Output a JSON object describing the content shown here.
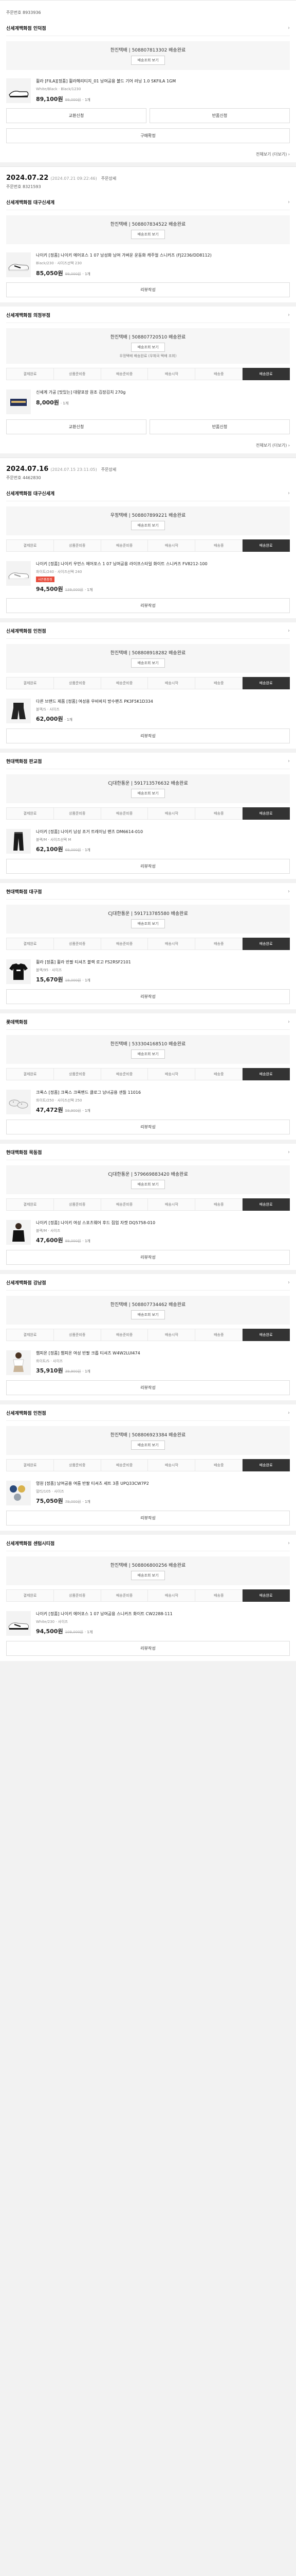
{
  "labels": {
    "ship_btn": "배송조회 보기",
    "exchange": "교환신청",
    "return": "반품신청",
    "confirm": "구매확정",
    "cancel": "취소요청",
    "review": "리뷰작성",
    "detail": "주문상세",
    "more": "전체보기 (더보기) ›",
    "qty": "· 1개"
  },
  "steps": [
    "결제완료",
    "상품준비중",
    "배송준비중",
    "배송시작",
    "배송중",
    "배송완료"
  ],
  "orders": [
    {
      "order_no": "주문번호 8933936",
      "shop": "신세계백화점 인덕점",
      "ship_title": "한진택배 | 508807813302 배송완료",
      "item": {
        "name": "휠라 [FILA][정품] 휠라헤리티지_01 남여공용 볼드 기어 러닝 1.0 SKFILA 1GM",
        "opt": "White/Black · Black/1230",
        "price": "89,100원",
        "orig": "99,000원"
      }
    },
    {
      "date": "2024.07.22",
      "date_sub": "(2024.07.21 09:22:46)",
      "order_no": "주문번호 8321593",
      "shop": "신세계백화점 대구신세계",
      "ship_title": "한진택배 | 508807834522 배송완료",
      "item": {
        "name": "나이키 [정품] 나이키 에어포스 1 07 남성화 남여 가벼운 운동화 캐주얼 스니커즈 (FJ2236/DD8112)",
        "opt": "Black/230 · 사이즈선택 230",
        "price": "85,050원",
        "orig": "99,000원"
      }
    },
    {
      "shop": "신세계백화점 의정부점",
      "ship_title": "한진택배 | 508807720510 배송완료",
      "item": {
        "name": "신세계 가공 [맛있는] 대량포장 원조 김장김치 270g",
        "opt": "",
        "price": "8,000원",
        "orig": ""
      },
      "extra_ship": "우정택배 배송완료 (우체국 택배 조회)"
    },
    {
      "date": "2024.07.16",
      "date_sub": "(2024.07.15 23:11:05)",
      "order_no": "주문번호 4462830",
      "shop": "신세계백화점 대구신세계",
      "ship_title": "우정택배 | 508807899221 배송완료",
      "item": {
        "name": "나이키 [정품] 나이키 우먼스 에어포스 1 07 남여공용 라이프스타일 화이트 스니커즈 FV8212-100",
        "opt": "화이트/240 · 사이즈선택 240",
        "price": "94,500원",
        "orig": "139,000원",
        "badge": "사은품증정"
      }
    },
    {
      "shop": "신세계백화점 인천점",
      "ship_title": "한진택배 | 508808918282 배송완료",
      "item": {
        "name": "다른 브랜드 제품 [정품] 여성용 우비바지 방수팬츠 PK3F5K1D334",
        "opt": "블랙/S · 사이즈",
        "price": "62,000원",
        "orig": ""
      }
    },
    {
      "shop": "현대백화점 판교점",
      "ship_title": "CJ대한통운 | 591713576632 배송완료",
      "item": {
        "name": "나이키 [정품] 나이키 남성 조거 트레이닝 팬츠 DM6614-010",
        "opt": "블랙/M · 사이즈선택 M",
        "price": "62,100원",
        "orig": "69,000원"
      }
    },
    {
      "shop": "현대백화점 대구점",
      "ship_title": "CJ대한통운 | 591713785580 배송완료",
      "item": {
        "name": "휠라 [정품] 휠라 반팔 티셔츠 블랙 로고 FS2RSF2101",
        "opt": "블랙/95 · 사이즈",
        "price": "15,670원",
        "orig": "19,000원"
      }
    },
    {
      "shop": "롯데백화점",
      "ship_title": "한진택배 | 533304168510 배송완료",
      "item": {
        "name": "크록스 [정품] 크록스 크록밴드 클로그 남녀공용 샌들 11016",
        "opt": "화이트/250 · 사이즈선택 250",
        "price": "47,472원",
        "orig": "59,900원"
      }
    },
    {
      "shop": "현대백화점 목동점",
      "ship_title": "CJ대한통운 | 579669883420 배송완료",
      "item": {
        "name": "나이키 [정품] 나이키 여성 스포츠웨어 후드 집업 자켓 DQ5758-010",
        "opt": "블랙/M · 사이즈",
        "price": "47,600원",
        "orig": "89,000원"
      }
    },
    {
      "shop": "신세계백화점 강남점",
      "ship_title": "한진택배 | 508807734462 배송완료",
      "item": {
        "name": "챔피온 [정품] 챔피온 여성 반팔 크롭 티셔츠 W4W2LUI474",
        "opt": "화이트/S · 사이즈",
        "price": "35,910원",
        "orig": "39,900원"
      }
    },
    {
      "shop": "신세계백화점 인천점",
      "ship_title": "한진택배 | 508806923384 배송완료",
      "item": {
        "name": "영원 [정품] 남여공용 여름 반팔 티셔츠 세트 3종 UPQ33CW7P2",
        "opt": "멀티/105 · 사이즈",
        "price": "75,050원",
        "orig": "79,000원"
      }
    },
    {
      "shop": "신세계백화점 센텀시티점",
      "ship_title": "한진택배 | 508806800256 배송완료",
      "item": {
        "name": "나이키 [정품] 나이키 에어포스 1 07 남여공용 스니커즈 화이트 CW2288-111",
        "opt": "White/230 · 사이즈",
        "price": "94,500원",
        "orig": "109,000원"
      }
    }
  ]
}
